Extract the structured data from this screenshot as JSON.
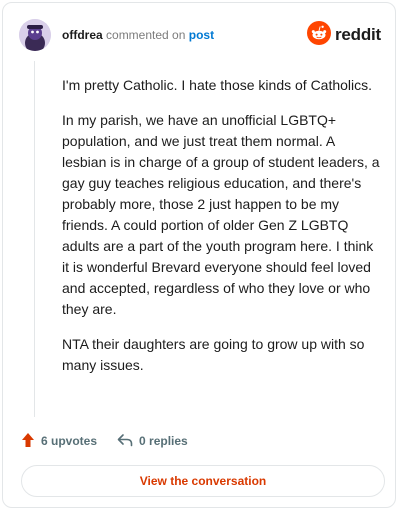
{
  "comment": {
    "username": "offdrea",
    "action_text": "commented on",
    "target_link": "post",
    "paragraphs": [
      "I'm pretty Catholic. I hate those kinds of Catholics.",
      "In my parish, we have an unofficial LGBTQ+ population, and we just treat them normal. A lesbian is in charge of a group of student leaders, a gay guy teaches religious education, and there's probably more, those 2 just happen to be my friends. A could portion of older Gen Z LGBTQ adults are a part of the youth program here. I think it is wonderful Brevard everyone should feel loved and accepted, regardless of who they love or who they are.",
      "NTA their daughters are going to grow up with so many issues."
    ]
  },
  "brand": {
    "name": "reddit",
    "icon": "reddit-logo-icon",
    "color": "#ff4500"
  },
  "footer": {
    "upvotes": "6 upvotes",
    "upvote_icon": "upvote-arrow-icon",
    "replies": "0 replies",
    "reply_icon": "reply-arrow-icon"
  },
  "cta": {
    "label": "View the conversation"
  },
  "colors": {
    "accent": "#d93900",
    "link": "#0079d3",
    "muted": "#576f76"
  }
}
